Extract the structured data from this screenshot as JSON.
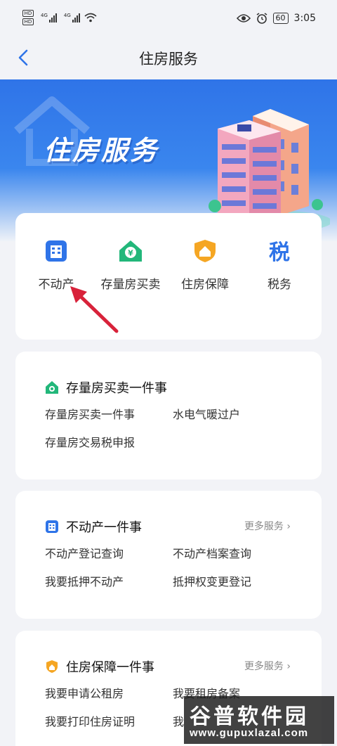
{
  "status_bar": {
    "hd1": "HD",
    "hd2": "HD",
    "net1": "4G",
    "net2": "4G",
    "battery": "60",
    "time": "3:05"
  },
  "nav": {
    "title": "住房服务"
  },
  "banner": {
    "title": "住房服务"
  },
  "services": [
    {
      "label": "不动产",
      "icon": "building-icon"
    },
    {
      "label": "存量房买卖",
      "icon": "house-yen-icon"
    },
    {
      "label": "住房保障",
      "icon": "shield-house-icon"
    },
    {
      "label": "税务",
      "icon": "tax-icon"
    }
  ],
  "sections": [
    {
      "title": "存量房买卖一件事",
      "more": "",
      "links": [
        "存量房买卖一件事",
        "水电气暖过户",
        "存量房交易税申报"
      ]
    },
    {
      "title": "不动产一件事",
      "more": "更多服务",
      "links": [
        "不动产登记查询",
        "不动产档案查询",
        "我要抵押不动产",
        "抵押权变更登记"
      ]
    },
    {
      "title": "住房保障一件事",
      "more": "更多服务",
      "links": [
        "我要申请公租房",
        "我要租房备案",
        "我要打印住房证明",
        "我"
      ]
    }
  ],
  "watermark": {
    "title": "谷普软件园",
    "url": "www.gupuxlazal.com"
  },
  "colors": {
    "accent": "#2f74e8",
    "green": "#22b77a",
    "orange": "#f5a623",
    "arrow": "#d8223a"
  }
}
